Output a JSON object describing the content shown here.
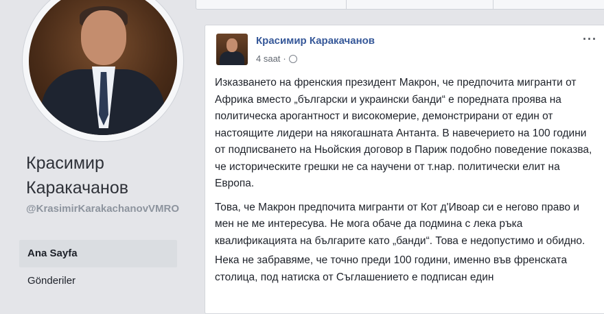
{
  "profile": {
    "name": "Красимир Каракачанов",
    "handle": "@KrasimirKarakachanovVMRO",
    "nav": [
      {
        "label": "Ana Sayfa",
        "active": true
      },
      {
        "label": "Gönderiler",
        "active": false
      }
    ]
  },
  "post": {
    "author": "Красимир Каракачанов",
    "time": "4 saat",
    "separator": "·",
    "more": "···",
    "paragraphs": [
      "Изказването на френския президент Макрон, че предпочита мигранти от Африка вместо „български и украински банди“ е поредната проява на политическа арогантност и високомерие, демонстрирани от един от настоящите лидери на някогашната Антанта. В навечерието на 100 години от подписването на Ньойския договор в Париж подобно поведение показва, че историческите грешки не са научени от т.нар. политически елит на Европа.",
      "Това, че Макрон предпочита мигранти от Кот д'Ивоар си е негово право и мен не ме интересува. Не мога обаче да подмина с лека ръка квалификацията на българите като „банди“. Това е недопустимо и обидно.",
      "Нека не забравяме, че точно преди 100 години, именно във френската столица, под натиска от Съглашението е подписан един"
    ]
  },
  "colors": {
    "background": "#e4e5e9",
    "author_link": "#365899",
    "card": "#ffffff",
    "muted_text": "#8d949e"
  }
}
